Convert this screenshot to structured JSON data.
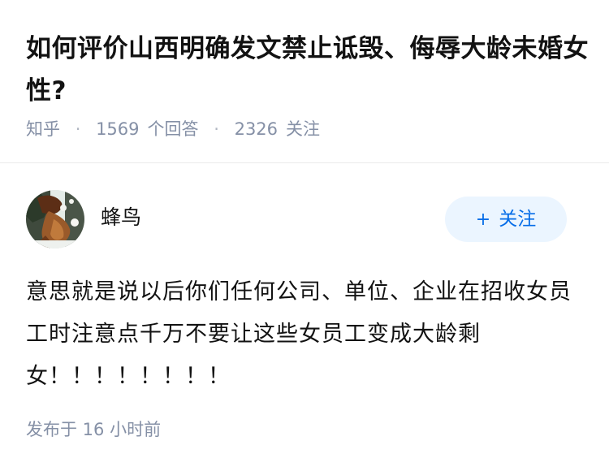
{
  "question": {
    "title": "如何评价山西明确发文禁止诋毁、侮辱大龄未婚女性?",
    "source": "知乎",
    "answer_count": "1569",
    "answer_label": "个回答",
    "follower_count": "2326",
    "follower_label": "关注",
    "separator": "·"
  },
  "answer": {
    "author": {
      "name": "蜂鸟",
      "avatar_icon": "avatar-photo-icon"
    },
    "follow_button": {
      "label": "关注",
      "icon": "plus-icon",
      "icon_glyph": "+"
    },
    "content": "意思就是说以后你们任何公司、单位、企业在招收女员工时注意点千万不要让这些女员工变成大龄剩女！！！！！！！！",
    "published_time": "发布于 16 小时前"
  },
  "colors": {
    "title": "#121212",
    "meta": "#8590a6",
    "follow_bg": "#ebf5ff",
    "follow_text": "#056de8",
    "divider": "#ebebeb"
  }
}
